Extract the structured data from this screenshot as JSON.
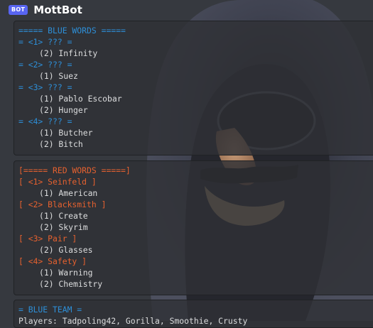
{
  "message": {
    "badge": "BOT",
    "username": "MottBot"
  },
  "blue_words": {
    "header": "===== BLUE WORDS =====",
    "groups": [
      {
        "label": "= <1> ??? =",
        "items": [
          "(2) Infinity"
        ]
      },
      {
        "label": "= <2> ??? =",
        "items": [
          "(1) Suez"
        ]
      },
      {
        "label": "= <3> ??? =",
        "items": [
          "(1) Pablo Escobar",
          "(2) Hunger"
        ]
      },
      {
        "label": "= <4> ??? =",
        "items": [
          "(1) Butcher",
          "(2) Bitch"
        ]
      }
    ]
  },
  "red_words": {
    "header": "[===== RED WORDS =====]",
    "groups": [
      {
        "label": "[ <1> Seinfeld ]",
        "items": [
          "(1) American"
        ]
      },
      {
        "label": "[ <2> Blacksmith ]",
        "items": [
          "(1) Create",
          "(2) Skyrim"
        ]
      },
      {
        "label": "[ <3> Pair ]",
        "items": [
          "(2) Glasses"
        ]
      },
      {
        "label": "[ <4> Safety ]",
        "items": [
          "(1) Warning",
          "(2) Chemistry"
        ]
      }
    ]
  },
  "blue_team": {
    "header": "= BLUE TEAM =",
    "line": "Players: Tadpoling42, Gorilla, Smoothie, Crusty"
  },
  "colors": {
    "blue_text": "#2d8fd8",
    "red_text": "#e6612f",
    "bot_badge": "#5865f2"
  },
  "icons": {
    "background": "hooded-figure-with-disguise-glasses"
  }
}
